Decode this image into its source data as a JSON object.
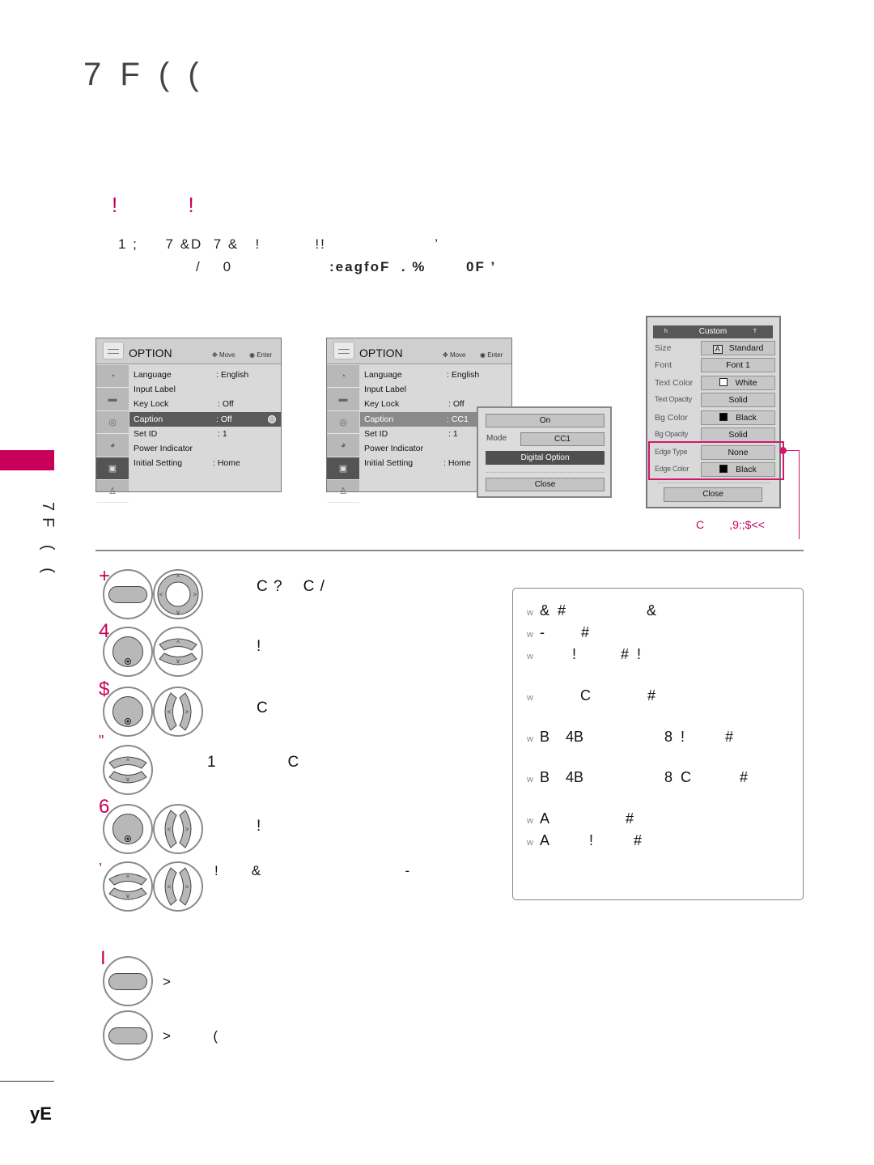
{
  "page": {
    "title": "7 F   ( (",
    "subtitle": "!  !",
    "intro_line1": "1 ;     7 &D  7 &   !          !!                    ’",
    "intro_line2_a": "/    0",
    "intro_line2_b": ":eagfoF  . %",
    "intro_line2_c": "0F ’",
    "side_label": "7F  ( (",
    "page_number": "yE",
    "accent_color": "#c8005a"
  },
  "menu1": {
    "title": "OPTION",
    "hint_move": "Move",
    "hint_enter": "Enter",
    "items": [
      {
        "label": "Language",
        "value": ": English"
      },
      {
        "label": "Input Label",
        "value": ""
      },
      {
        "label": "Key Lock",
        "value": ": Off"
      },
      {
        "label": "Caption",
        "value": ": Off"
      },
      {
        "label": "Set ID",
        "value": ": 1"
      },
      {
        "label": "Power Indicator",
        "value": ""
      },
      {
        "label": "Initial Setting",
        "value": ": Home"
      }
    ],
    "selected_index": 3
  },
  "menu2": {
    "title": "OPTION",
    "hint_move": "Move",
    "hint_enter": "Enter",
    "items": [
      {
        "label": "Language",
        "value": ": English"
      },
      {
        "label": "Input Label",
        "value": ""
      },
      {
        "label": "Key Lock",
        "value": ": Off"
      },
      {
        "label": "Caption",
        "value": ": CC1"
      },
      {
        "label": "Set ID",
        "value": ": 1"
      },
      {
        "label": "Power Indicator",
        "value": ""
      },
      {
        "label": "Initial Setting",
        "value": ": Home"
      }
    ],
    "popup": {
      "on_label": "On",
      "mode_label": "Mode",
      "mode_value": "CC1",
      "digital_option_label": "Digital Option",
      "close_label": "Close"
    }
  },
  "custom_menu": {
    "header": "Custom",
    "left_arrow": "h",
    "right_arrow": "T",
    "rows": [
      {
        "label": "Size",
        "value": "Standard",
        "swatch": "A"
      },
      {
        "label": "Font",
        "value": "Font 1",
        "swatch": ""
      },
      {
        "label": "Text Color",
        "value": "White",
        "swatch": "white"
      },
      {
        "label": "Text Opacity",
        "value": "Solid",
        "swatch": ""
      },
      {
        "label": "Bg Color",
        "value": "Black",
        "swatch": "black"
      },
      {
        "label": "Bg Opacity",
        "value": "Solid",
        "swatch": ""
      },
      {
        "label": "Edge Type",
        "value": "None",
        "swatch": ""
      },
      {
        "label": "Edge Color",
        "value": "Black",
        "swatch": "black"
      }
    ],
    "close_label": "Close",
    "callout_text": "C        ,9:;$<<"
  },
  "steps": [
    {
      "num": "+",
      "text": "C ?    C /"
    },
    {
      "num": "4",
      "text": "!"
    },
    {
      "num": "$",
      "text": "C"
    },
    {
      "num": "\"",
      "text": "1              C"
    },
    {
      "num": "6",
      "text": "!"
    },
    {
      "num": "’",
      "text": "!       &                               -"
    }
  ],
  "return_steps": {
    "num": "I",
    "items": [
      {
        "text": ">"
      },
      {
        "text": ">         ("
      }
    ]
  },
  "notes": [
    "&  #                    &",
    "-         #",
    "        !           #  !",
    "          C              #",
    "B    4B                    8  !          #",
    "B    4B                    8  C            #",
    "A                   #",
    "A          !          #"
  ],
  "note_bullet": "w"
}
